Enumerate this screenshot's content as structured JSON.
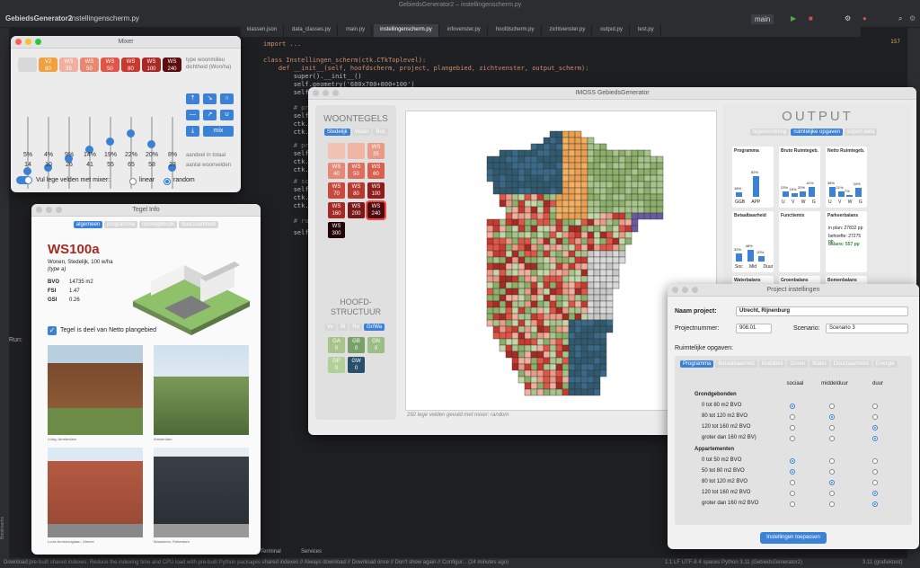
{
  "ide": {
    "title": "GebiedsGenerator2 – instellingenscherm.py",
    "project_button": "GebiedsGenerator2",
    "project_file": "instellingenscherm.py",
    "project_panel": "Project",
    "branch": "main",
    "tabs": [
      "klassen.json",
      "data_classes.py",
      "main.py",
      "instellingenscherm.py",
      "infovenster.py",
      "hoofdscherm.py",
      "zichtvenster.py",
      "output.py",
      "test.py"
    ],
    "code_lines": [
      "import ...",
      "class Instellingen_scherm(ctk.CTkToplevel):",
      "    def __init__(self, hoofdscherm, project, plangebied, zichtvenster, output_scherm):",
      "        super().__init__()",
      "        self.geometry('680x780+800+100')",
      "        self.title(",
      "        # projectn",
      "        self.proj",
      "        ctk.CTkLab",
      "        ctk.CTkEnt",
      "        # projectn",
      "        self.proj",
      "        ctk.CTkLab",
      "        ctk.CTkEnt",
      "        # scenariu",
      "        self.proj",
      "        ctk.CTkLab",
      "        ctk.CTkEnt",
      "        # ruimtel",
      "        self.opgav"
    ],
    "status": "Download pre-built shared indexes: Reduce the indexing time and CPU load with pre-built Python packages shared indexes // Always download // Download once // Don't show again // Configur... (24 minutes ago)",
    "status_right": "1:1   LF   UTF-8   4 spaces   Python 3.11 (GebiedsGenerator2)",
    "version": "3.11 (grafiektest)",
    "warnings": "157",
    "run": "Run:",
    "bookmarks": "Bookmarks",
    "structure": "Structure",
    "services": "Services",
    "terminal": "Terminal",
    "version_control": "Version Control"
  },
  "mixer": {
    "title": "Mixer",
    "chips": [
      {
        "label": "",
        "color": "#d8d8d8"
      },
      {
        "label": "V2\n80",
        "color": "#f0a040"
      },
      {
        "label": "WS\n35",
        "color": "#f0b0a0"
      },
      {
        "label": "WS\n50",
        "color": "#e88870"
      },
      {
        "label": "WS\n50",
        "color": "#e05545"
      },
      {
        "label": "WS\n80",
        "color": "#c83a30"
      },
      {
        "label": "WS\n100",
        "color": "#a82a24"
      },
      {
        "label": "WS\n240",
        "color": "#5a0e10"
      }
    ],
    "type_label": "type woonmilieu",
    "density_label": "dichtheid (Won/ha)",
    "levels": [
      0.25,
      0.3,
      0.43,
      0.55,
      0.66,
      0.78,
      0.63,
      0.3
    ],
    "percents": [
      "5%",
      "4%",
      "9%",
      "14%",
      "19%",
      "22%",
      "20%",
      "8%"
    ],
    "counts": [
      "14",
      "10",
      "26",
      "41",
      "55",
      "65",
      "58",
      "23"
    ],
    "share_label": "aandeel in totaal",
    "count_label": "aantal woonvelden",
    "fill_label": "Vul lege velden met mixer:",
    "opt_linear": "linear",
    "opt_random": "random",
    "mix_button": "mix"
  },
  "tegel": {
    "title": "Tegel Info",
    "tabs": [
      "algemeen",
      "programma",
      "ruimtegebruik",
      "duurzaamheid"
    ],
    "name": "WS100a",
    "desc": "Wonen, Stedelijk, 100 w/ha",
    "type": "(type a)",
    "stats": [
      {
        "k": "BVO",
        "v": "14735 m2"
      },
      {
        "k": "FSI",
        "v": "1.47"
      },
      {
        "k": "GSI",
        "v": "0.26"
      }
    ],
    "checkbox_label": "Tegel is deel van Netto plangebied",
    "captions": [
      "Lüsig, Amsterdam",
      "Amsterdam",
      "Louis Armstronglaan, Utrecht",
      "Maastoren, Rotterdam"
    ]
  },
  "imoss": {
    "title": "IMOSS GebiedsGenerator",
    "woontegels": "WOONTEGELS",
    "woon_tabs": [
      "Stedelijk",
      "Water",
      "Bos"
    ],
    "tiles": [
      {
        "l": "",
        "c": "#f2c2b4"
      },
      {
        "l": "",
        "c": "#efb6a4"
      },
      {
        "l": "WS\n35",
        "c": "#ea9a86"
      },
      {
        "l": "WS\n40",
        "c": "#e58a78"
      },
      {
        "l": "WS\n50",
        "c": "#df6e5e"
      },
      {
        "l": "WS\n60",
        "c": "#d9604f"
      },
      {
        "l": "WS\n70",
        "c": "#c84a3e"
      },
      {
        "l": "WS\n80",
        "c": "#b8392f"
      },
      {
        "l": "WS\n100",
        "c": "#8e1d1c"
      },
      {
        "l": "WS\n160",
        "c": "#a22b24"
      },
      {
        "l": "WS\n200",
        "c": "#7a1819"
      },
      {
        "l": "WS\n240",
        "c": "#4a0b0d"
      },
      {
        "l": "WS\n300",
        "c": "#200406"
      }
    ],
    "hoofd": "HOOFD-\nSTRUCTUUR",
    "hoofd_tabs": [
      "Ve",
      "Bl",
      "Ro",
      "Gr/Wa"
    ],
    "green_tiles": [
      {
        "l": "GA\n0",
        "c": "#a8c48c"
      },
      {
        "l": "GB\n0",
        "c": "#7aa06a"
      },
      {
        "l": "GN\n0",
        "c": "#9bbf82"
      },
      {
        "l": "GP\n0",
        "c": "#b4d09a"
      },
      {
        "l": "GW\n0",
        "c": "#28506a"
      }
    ],
    "footer": "292 lege velden gevuld met mixer: random",
    "output": "OUTPUT",
    "out_tabs": [
      "tegelverdeling",
      "ruimtelijke opgaven",
      "export-data"
    ],
    "cards": [
      {
        "t": "Programma",
        "vals": [
          "18%",
          "82%"
        ],
        "bars": [
          18,
          82
        ],
        "xl": "GGB APP"
      },
      {
        "t": "Bruto Ruimtegeb.",
        "vals": [
          "23%",
          "16%",
          "20%",
          "41%"
        ],
        "bars": [
          23,
          16,
          20,
          41
        ],
        "xl": "U V W G"
      },
      {
        "t": "Netto Ruimtegeb.",
        "vals": [
          "38%",
          "21%",
          "7%",
          "34%"
        ],
        "bars": [
          38,
          21,
          7,
          34
        ],
        "xl": "U V W G"
      },
      {
        "t": "Betaalbaarheid",
        "vals": [
          "32%",
          "48%",
          "20%"
        ],
        "bars": [
          32,
          48,
          20
        ],
        "xl": "Soc Mid Duur"
      },
      {
        "t": "Functiemix",
        "vals": [],
        "bars": [],
        "xl": ""
      },
      {
        "t": "Parkeerbalans",
        "vals": [],
        "bars": [],
        "xl": ""
      }
    ],
    "park_lines": [
      "in plan: 27832 pp",
      "behoefte: 27275 pp",
      "balans: 557 pp"
    ],
    "row3": [
      "Waterbalans",
      "Groenbalans",
      "Bomenbalans"
    ]
  },
  "project": {
    "title": "Project instellingen",
    "name_label": "Naam project:",
    "name": "Utrecht, Rijnenburg",
    "nr_label": "Projectnummer:",
    "nr": "908.01",
    "sc_label": "Scenario:",
    "scenario": "Scenario 3",
    "opg_label": "Ruimtelijke opgaven:",
    "tabs": [
      "Programma",
      "Betaalbaarheid",
      "Mobiliteit",
      "Groen",
      "Water",
      "Duurzaamheid",
      "Energie"
    ],
    "cols": [
      "sociaal",
      "middelduur",
      "duur"
    ],
    "g1": "Grondgebonden",
    "rows1": [
      "0 tot 80 m2 BVO",
      "80 tot 120 m2 BVO",
      "120 tot 160 m2 BVO",
      "groter dan 160 m2 BV)"
    ],
    "g2": "Appartementen",
    "rows2": [
      "0 tot 50 m2 BVO",
      "50 tot 80 m2 BVO",
      "80 tot 120 m2 BVO",
      "120 tot 160 m2 BVO",
      "groter dan 160 m2 BVO"
    ],
    "sel1": [
      0,
      1,
      2,
      2
    ],
    "sel2": [
      0,
      0,
      1,
      2,
      2
    ],
    "apply": "Instellingen toepassen"
  }
}
